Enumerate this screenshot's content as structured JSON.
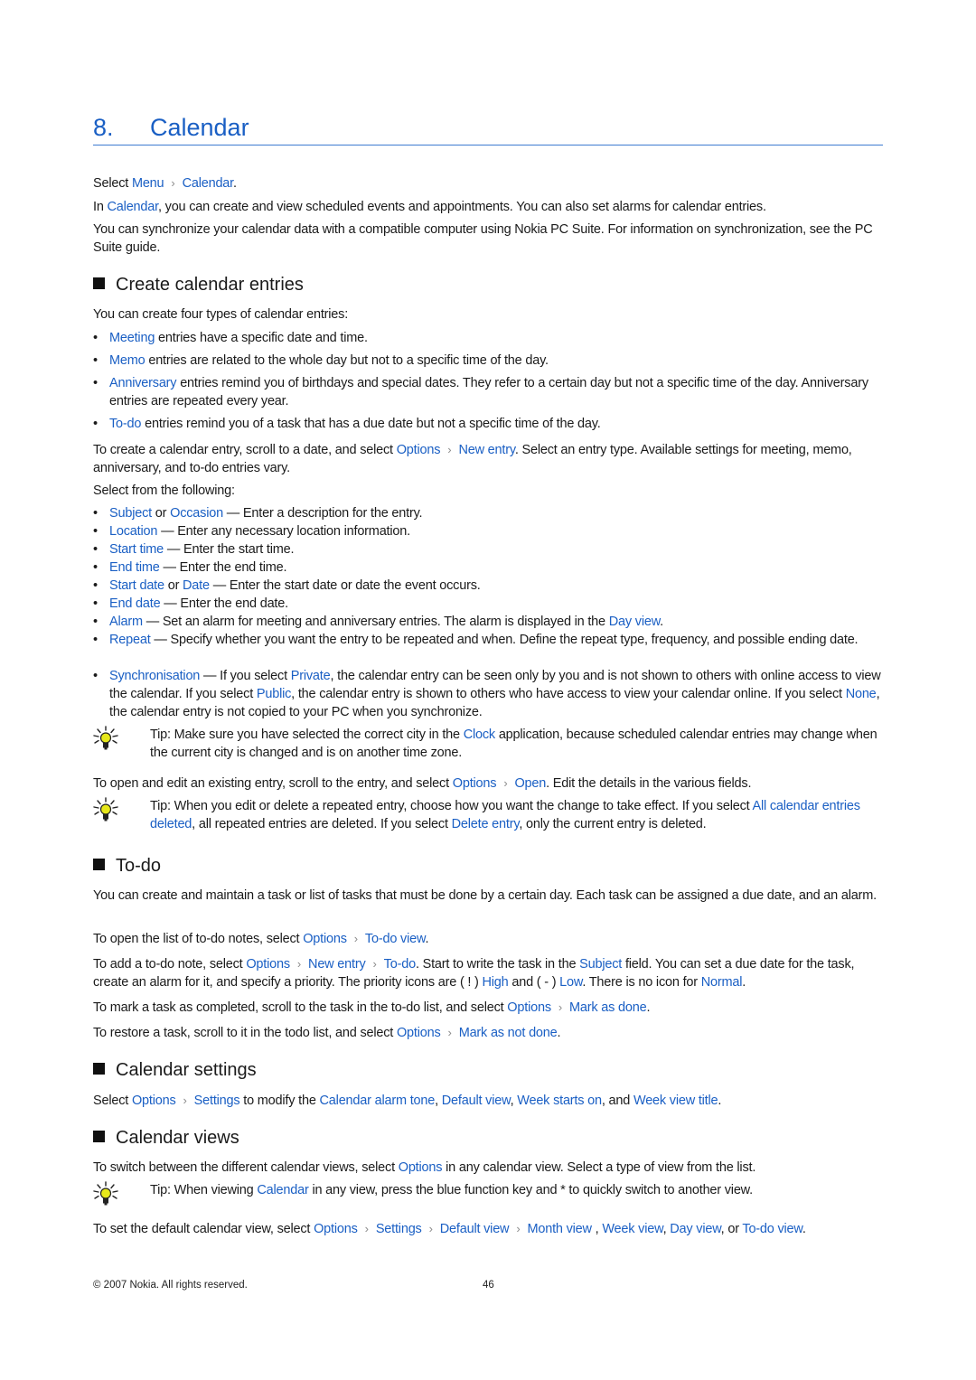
{
  "chapter": {
    "number": "8.",
    "title": "Calendar"
  },
  "intro": {
    "select": [
      "Select ",
      {
        "l": "Menu"
      },
      {
        "sep": true
      },
      {
        "l": "Calendar"
      },
      "."
    ],
    "p1": [
      "In ",
      {
        "l": "Calendar"
      },
      ", you can create and view scheduled events and appointments. You can also set alarms for calendar entries."
    ],
    "p2": [
      "You can synchronize your calendar data with a compatible computer using Nokia PC Suite. For information on synchronization, see the PC Suite guide."
    ]
  },
  "sections": {
    "create": {
      "heading": "Create calendar entries",
      "lead": [
        "You can create four types of calendar entries:"
      ],
      "types": [
        [
          {
            "l": "Meeting"
          },
          " entries have a specific date and time."
        ],
        [
          {
            "l": "Memo"
          },
          " entries are related to the whole day but not to a specific time of the day."
        ],
        [
          {
            "l": "Anniversary"
          },
          " entries remind you of birthdays and special dates. They refer to a certain day but not a specific time of the day. Anniversary entries are repeated every year."
        ],
        [
          {
            "l": "To-do"
          },
          " entries remind you of a task that has a due date but not a specific time of the day."
        ]
      ],
      "howto": [
        "To create a calendar entry, scroll to a date, and select ",
        {
          "l": "Options"
        },
        {
          "sep": true
        },
        {
          "l": "New entry"
        },
        ". Select an entry type. Available settings for meeting, memo, anniversary, and to-do entries vary."
      ],
      "select_from": [
        "Select from the following:"
      ],
      "fields": [
        [
          {
            "l": "Subject"
          },
          " or ",
          {
            "l": "Occasion"
          },
          " — Enter a description for the entry."
        ],
        [
          {
            "l": "Location"
          },
          " — Enter any necessary location information."
        ],
        [
          {
            "l": "Start time"
          },
          " — Enter the start time."
        ],
        [
          {
            "l": "End time"
          },
          " — Enter the end time."
        ],
        [
          {
            "l": "Start date"
          },
          " or ",
          {
            "l": "Date"
          },
          " — Enter the start date or date the event occurs."
        ],
        [
          {
            "l": "End date"
          },
          " — Enter the end date."
        ],
        [
          {
            "l": "Alarm"
          },
          " — Set an alarm for meeting and anniversary entries. The alarm is displayed in the ",
          {
            "l": "Day view"
          },
          "."
        ],
        [
          {
            "l": "Repeat"
          },
          " — Specify whether you want the entry to be repeated and when. Define the repeat type, frequency, and possible ending date."
        ],
        [
          {
            "l": "Synchronisation"
          },
          " — If you select ",
          {
            "l": "Private"
          },
          ", the calendar entry can be seen only by you and is not shown to others with online access to view the calendar. If you select ",
          {
            "l": "Public"
          },
          ", the calendar entry is shown to others who have access to view your calendar online. If you select ",
          {
            "l": "None"
          },
          ", the calendar entry is not copied to your PC when you synchronize."
        ]
      ],
      "tip1": [
        "Tip: Make sure you have selected the correct city in the ",
        {
          "l": "Clock"
        },
        " application, because scheduled calendar entries may change when the current city is changed and is on another time zone."
      ],
      "open": [
        "To open and edit an existing entry, scroll to the entry, and select ",
        {
          "l": "Options"
        },
        {
          "sep": true
        },
        {
          "l": "Open"
        },
        ". Edit the details in the various fields."
      ],
      "tip2": [
        "Tip:  When you edit or delete a repeated entry, choose how you want the change to take effect. If you select ",
        {
          "l": "All calendar entries deleted"
        },
        ", all repeated entries are deleted. If you select ",
        {
          "l": "Delete entry"
        },
        ", only the current entry is deleted."
      ]
    },
    "todo": {
      "heading": "To-do",
      "p1": [
        "You can create and maintain a task or list of tasks that must be done by a certain day. Each task can be assigned a due date, and an alarm."
      ],
      "p2": [
        "To open the list of to-do notes, select ",
        {
          "l": "Options"
        },
        {
          "sep": true
        },
        {
          "l": "To-do view"
        },
        "."
      ],
      "p3": [
        "To add a to-do note, select ",
        {
          "l": "Options"
        },
        {
          "sep": true
        },
        {
          "l": "New entry"
        },
        {
          "sep": true
        },
        {
          "l": "To-do"
        },
        ". Start to write the task in the ",
        {
          "l": "Subject"
        },
        " field. You can set a due date for the task, create an alarm for it, and specify a priority. The priority icons are ( ! ) ",
        {
          "l": "High"
        },
        " and ( - ) ",
        {
          "l": "Low"
        },
        ". There is no icon for ",
        {
          "l": "Normal"
        },
        "."
      ],
      "p4": [
        "To mark a task as completed, scroll to the task in the to-do list, and select ",
        {
          "l": "Options"
        },
        {
          "sep": true
        },
        {
          "l": "Mark as done"
        },
        "."
      ],
      "p5": [
        "To restore a task, scroll to it in the todo list, and select ",
        {
          "l": "Options"
        },
        {
          "sep": true
        },
        {
          "l": "Mark as not done"
        },
        "."
      ]
    },
    "settings": {
      "heading": "Calendar settings",
      "p1": [
        "Select ",
        {
          "l": "Options"
        },
        {
          "sep": true
        },
        {
          "l": "Settings"
        },
        " to modify the ",
        {
          "l": "Calendar alarm tone"
        },
        ", ",
        {
          "l": "Default view"
        },
        ", ",
        {
          "l": "Week starts on"
        },
        ", and ",
        {
          "l": "Week view title"
        },
        "."
      ]
    },
    "views": {
      "heading": "Calendar views",
      "p1": [
        "To switch between the different calendar views, select ",
        {
          "l": "Options"
        },
        " in any calendar view. Select a type of view from the list."
      ],
      "tip": [
        "Tip: When viewing ",
        {
          "l": "Calendar"
        },
        " in any view, press the blue function key and * to quickly switch to another view."
      ],
      "p2": [
        "To set the default calendar view, select ",
        {
          "l": "Options"
        },
        {
          "sep": true
        },
        {
          "l": "Settings"
        },
        {
          "sep": true
        },
        {
          "l": "Default view"
        },
        {
          "sep": true
        },
        {
          "l": "Month view"
        },
        " , ",
        {
          "l": "Week view"
        },
        ", ",
        {
          "l": "Day view"
        },
        ", or ",
        {
          "l": "To-do view"
        },
        "."
      ]
    }
  },
  "footer": {
    "copyright": "© 2007 Nokia. All rights reserved.",
    "page_number": "46"
  },
  "colors": {
    "link": "#1a5fc4",
    "rule": "#3d7bd1",
    "text": "#1a1a1a"
  },
  "icons": {
    "tip": "lightbulb-icon",
    "separator": "chevron-right-icon",
    "bullet": "bullet-dot",
    "heading_marker": "square-marker"
  }
}
